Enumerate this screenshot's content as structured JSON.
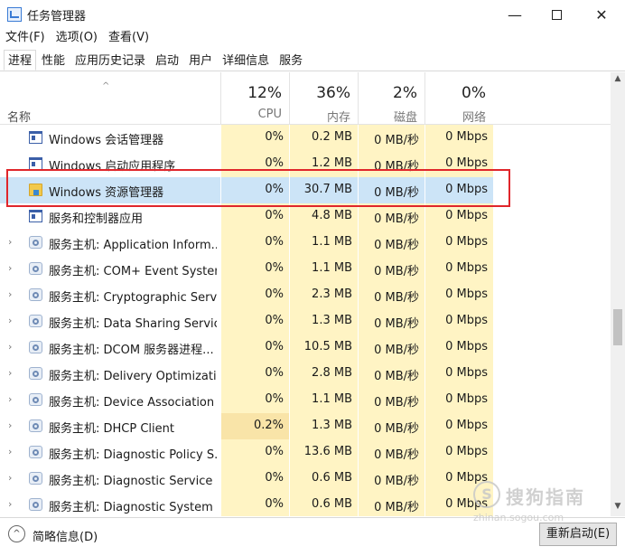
{
  "window": {
    "title": "任务管理器",
    "min_glyph": "—",
    "close_glyph": "✕"
  },
  "menu": [
    "文件(F)",
    "选项(O)",
    "查看(V)"
  ],
  "tabs": [
    {
      "label": "进程",
      "active": true
    },
    {
      "label": "性能",
      "active": false
    },
    {
      "label": "应用历史记录",
      "active": false
    },
    {
      "label": "启动",
      "active": false
    },
    {
      "label": "用户",
      "active": false
    },
    {
      "label": "详细信息",
      "active": false
    },
    {
      "label": "服务",
      "active": false
    }
  ],
  "header": {
    "sort_glyph": "^",
    "name_label": "名称",
    "columns": [
      {
        "key": "cpu",
        "pct": "12%",
        "label": "CPU"
      },
      {
        "key": "mem",
        "pct": "36%",
        "label": "内存"
      },
      {
        "key": "disk",
        "pct": "2%",
        "label": "磁盘"
      },
      {
        "key": "net",
        "pct": "0%",
        "label": "网络"
      }
    ]
  },
  "rows": [
    {
      "name": "Windows 会话管理器",
      "icon": "window-icon",
      "expandable": false,
      "selected": false,
      "cpu": "0%",
      "mem": "0.2 MB",
      "disk": "0 MB/秒",
      "net": "0 Mbps"
    },
    {
      "name": "Windows 启动应用程序",
      "icon": "window-icon",
      "expandable": false,
      "selected": false,
      "cpu": "0%",
      "mem": "1.2 MB",
      "disk": "0 MB/秒",
      "net": "0 Mbps"
    },
    {
      "name": "Windows 资源管理器",
      "icon": "folder-icon",
      "expandable": false,
      "selected": true,
      "cpu": "0%",
      "mem": "30.7 MB",
      "disk": "0 MB/秒",
      "net": "0 Mbps"
    },
    {
      "name": "服务和控制器应用",
      "icon": "window-icon",
      "expandable": false,
      "selected": false,
      "cpu": "0%",
      "mem": "4.8 MB",
      "disk": "0 MB/秒",
      "net": "0 Mbps"
    },
    {
      "name": "服务主机: Application Inform...",
      "icon": "gear-icon",
      "expandable": true,
      "selected": false,
      "cpu": "0%",
      "mem": "1.1 MB",
      "disk": "0 MB/秒",
      "net": "0 Mbps"
    },
    {
      "name": "服务主机: COM+ Event System",
      "icon": "gear-icon",
      "expandable": true,
      "selected": false,
      "cpu": "0%",
      "mem": "1.1 MB",
      "disk": "0 MB/秒",
      "net": "0 Mbps"
    },
    {
      "name": "服务主机: Cryptographic Serv...",
      "icon": "gear-icon",
      "expandable": true,
      "selected": false,
      "cpu": "0%",
      "mem": "2.3 MB",
      "disk": "0 MB/秒",
      "net": "0 Mbps"
    },
    {
      "name": "服务主机: Data Sharing Service",
      "icon": "gear-icon",
      "expandable": true,
      "selected": false,
      "cpu": "0%",
      "mem": "1.3 MB",
      "disk": "0 MB/秒",
      "net": "0 Mbps"
    },
    {
      "name": "服务主机: DCOM 服务器进程...",
      "icon": "gear-icon",
      "expandable": true,
      "selected": false,
      "cpu": "0%",
      "mem": "10.5 MB",
      "disk": "0 MB/秒",
      "net": "0 Mbps"
    },
    {
      "name": "服务主机: Delivery Optimizati...",
      "icon": "gear-icon",
      "expandable": true,
      "selected": false,
      "cpu": "0%",
      "mem": "2.8 MB",
      "disk": "0 MB/秒",
      "net": "0 Mbps"
    },
    {
      "name": "服务主机: Device Association ...",
      "icon": "gear-icon",
      "expandable": true,
      "selected": false,
      "cpu": "0%",
      "mem": "1.1 MB",
      "disk": "0 MB/秒",
      "net": "0 Mbps"
    },
    {
      "name": "服务主机: DHCP Client",
      "icon": "gear-icon",
      "expandable": true,
      "selected": false,
      "cpu": "0.2%",
      "mem": "1.3 MB",
      "disk": "0 MB/秒",
      "net": "0 Mbps",
      "cpu_hot": true
    },
    {
      "name": "服务主机: Diagnostic Policy S...",
      "icon": "gear-icon",
      "expandable": true,
      "selected": false,
      "cpu": "0%",
      "mem": "13.6 MB",
      "disk": "0 MB/秒",
      "net": "0 Mbps"
    },
    {
      "name": "服务主机: Diagnostic Service ...",
      "icon": "gear-icon",
      "expandable": true,
      "selected": false,
      "cpu": "0%",
      "mem": "0.6 MB",
      "disk": "0 MB/秒",
      "net": "0 Mbps"
    },
    {
      "name": "服务主机: Diagnostic System ...",
      "icon": "gear-icon",
      "expandable": true,
      "selected": false,
      "cpu": "0%",
      "mem": "0.6 MB",
      "disk": "0 MB/秒",
      "net": "0 Mbps"
    }
  ],
  "footer": {
    "expand_glyph": "^",
    "fewer_details": "简略信息(D)",
    "restart_button": "重新启动(E)"
  },
  "watermark": {
    "logo": "S",
    "text": "搜狗指南",
    "url": "zhinan.sogou.com"
  },
  "colors": {
    "selected_row": "#cce4f7",
    "metric_bg": "#fff4c4",
    "highlight_box": "#e0262b"
  }
}
